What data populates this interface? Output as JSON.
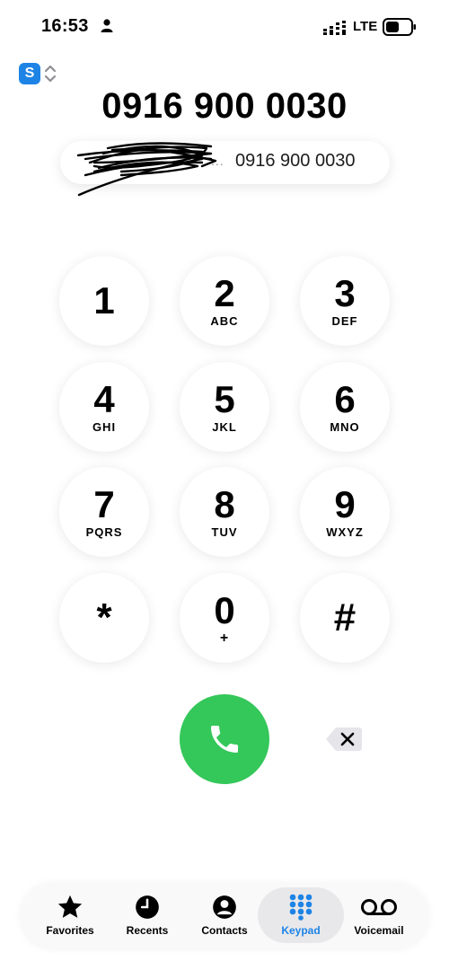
{
  "status_bar": {
    "time": "16:53",
    "network": "LTE"
  },
  "sim": {
    "badge": "S"
  },
  "dialed_number": "0916 900 0030",
  "suggestion": {
    "ellipsis": "...",
    "number": "0916 900 0030"
  },
  "keypad": [
    {
      "digit": "1",
      "letters": ""
    },
    {
      "digit": "2",
      "letters": "ABC"
    },
    {
      "digit": "3",
      "letters": "DEF"
    },
    {
      "digit": "4",
      "letters": "GHI"
    },
    {
      "digit": "5",
      "letters": "JKL"
    },
    {
      "digit": "6",
      "letters": "MNO"
    },
    {
      "digit": "7",
      "letters": "PQRS"
    },
    {
      "digit": "8",
      "letters": "TUV"
    },
    {
      "digit": "9",
      "letters": "WXYZ"
    },
    {
      "digit": "*",
      "letters": ""
    },
    {
      "digit": "0",
      "letters": "+"
    },
    {
      "digit": "#",
      "letters": ""
    }
  ],
  "tabs": [
    {
      "label": "Favorites",
      "icon": "star-icon"
    },
    {
      "label": "Recents",
      "icon": "clock-icon"
    },
    {
      "label": "Contacts",
      "icon": "person-circle-icon"
    },
    {
      "label": "Keypad",
      "icon": "keypad-grid-icon",
      "active": true
    },
    {
      "label": "Voicemail",
      "icon": "voicemail-icon"
    }
  ],
  "colors": {
    "accent": "#1d84e6",
    "call_green": "#34c759"
  }
}
